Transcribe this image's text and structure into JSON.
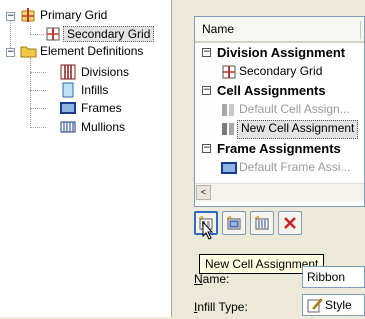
{
  "tree": {
    "items": [
      {
        "label": "Primary Grid",
        "expanded": true
      },
      {
        "label": "Secondary Grid",
        "selected": true
      },
      {
        "label": "Element Definitions",
        "expanded": true
      },
      {
        "label": "Divisions"
      },
      {
        "label": "Infills"
      },
      {
        "label": "Frames"
      },
      {
        "label": "Mullions"
      }
    ]
  },
  "list": {
    "column_header": "Name",
    "groups": [
      {
        "label": "Division Assignment",
        "items": [
          {
            "label": "Secondary Grid"
          }
        ]
      },
      {
        "label": "Cell Assignments",
        "items": [
          {
            "label": "Default Cell Assign..."
          },
          {
            "label": "New Cell Assignment",
            "selected": true
          }
        ]
      },
      {
        "label": "Frame Assignments",
        "items": [
          {
            "label": "Default Frame Assi..."
          }
        ]
      }
    ],
    "scroll_left_glyph": "<"
  },
  "toolbar": {
    "buttons": [
      "new-cell-assignment-icon",
      "new-assignment-icon",
      "new-assignment-alt-icon",
      "delete-icon"
    ],
    "tooltip": "New Cell Assignment"
  },
  "properties": {
    "name_label_prefix": "N",
    "name_label_rest": "ame:",
    "name_value": "Ribbon",
    "infill_label_prefix": "I",
    "infill_label_rest": "nfill Type:",
    "infill_value": "Style"
  },
  "colors": {
    "selection": "#e3e3e3",
    "tooltip_bg": "#ffffe1",
    "delete_red": "#cc2222",
    "frame_blue": "#2a4fa8",
    "folder_yellow": "#f2c744"
  }
}
